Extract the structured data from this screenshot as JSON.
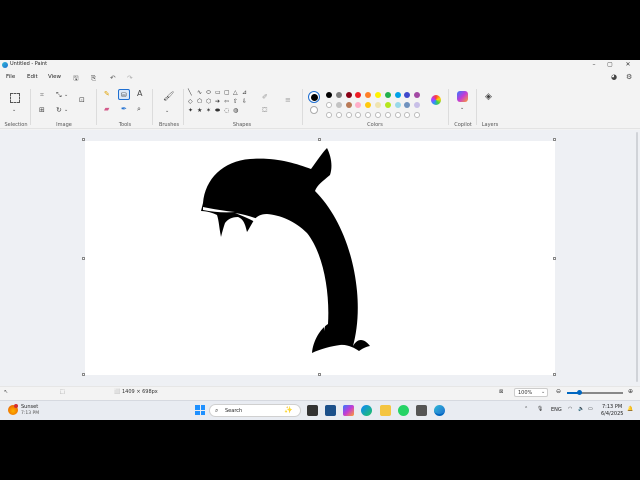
{
  "window": {
    "title": "Untitled - Paint"
  },
  "menu": {
    "file": "File",
    "edit": "Edit",
    "view": "View"
  },
  "ribbon": {
    "groups": {
      "selection": "Selection",
      "image": "Image",
      "tools": "Tools",
      "brushes": "Brushes",
      "shapes": "Shapes",
      "colors": "Colors",
      "copilot": "Copilot",
      "layers": "Layers"
    },
    "tools_text_glyph": "A",
    "palette_row1": [
      "#000000",
      "#7f7f7f",
      "#880015",
      "#ed1c24",
      "#ff7f27",
      "#fff200",
      "#22b14c",
      "#00a2e8",
      "#3f48cc",
      "#a349a4"
    ],
    "palette_row2": [
      "#ffffff",
      "#c3c3c3",
      "#b97a57",
      "#ffaec9",
      "#ffc90e",
      "#efe4b0",
      "#b5e61d",
      "#99d9ea",
      "#7092be",
      "#c8bfe7"
    ],
    "shapes": [
      "╲",
      "∿",
      "⬭",
      "▭",
      "▢",
      "△",
      "⊿",
      "◇",
      "⬠",
      "⬡",
      "➔",
      "⇦",
      "⇧",
      "⇩",
      "✦",
      "★",
      "✶",
      "⬬",
      "◌",
      "◍"
    ]
  },
  "statusbar": {
    "canvas_size": "1409 × 698px",
    "zoom": "100%",
    "zoom_minus": "⊖",
    "zoom_plus": "⊕"
  },
  "taskbar": {
    "weather_title": "Sunset",
    "weather_time": "7:13 PM",
    "search_placeholder": "Search",
    "lang": "ENG",
    "time": "7:13 PM",
    "date": "6/4/2025"
  },
  "colors": {
    "accent": "#0067c0",
    "canvas_bg": "#ffffff",
    "workspace_bg": "#eef0f4"
  }
}
